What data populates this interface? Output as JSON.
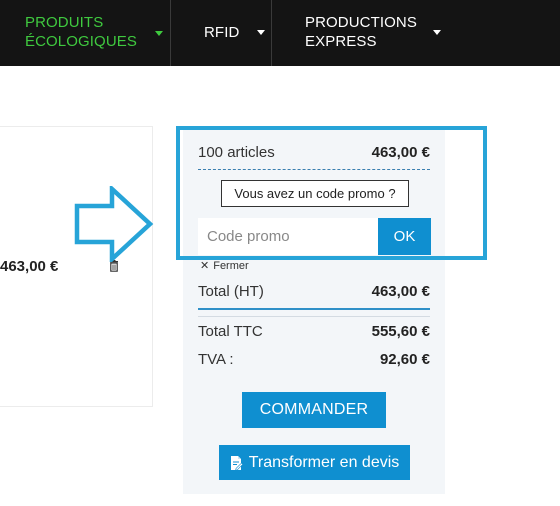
{
  "nav": {
    "items": [
      {
        "line1": "PRODUITS",
        "line2": "ÉCOLOGIQUES"
      },
      {
        "line1": "RFID",
        "line2": ""
      },
      {
        "line1": "PRODUCTIONS",
        "line2": "EXPRESS"
      }
    ],
    "active_color": "#3fc93f"
  },
  "product": {
    "price": "463,00 €",
    "delete_icon": "trash-icon"
  },
  "summary": {
    "articles_label": "100 articles",
    "articles_value": "463,00 €",
    "promo_toggle_label": "Vous avez un code promo ?",
    "promo_placeholder": "Code promo",
    "promo_submit": "OK",
    "close_label": "Fermer",
    "total_ht_label": "Total (HT)",
    "total_ht_value": "463,00 €",
    "total_ttc_label": "Total TTC",
    "total_ttc_value": "555,60 €",
    "tva_label": "TVA :",
    "tva_value": "92,60 €",
    "order_button": "COMMANDER",
    "quote_button": "Transformer en devis"
  },
  "colors": {
    "accent": "#0f8fd0",
    "highlight": "#27a4d8",
    "nav_background": "#141414"
  }
}
